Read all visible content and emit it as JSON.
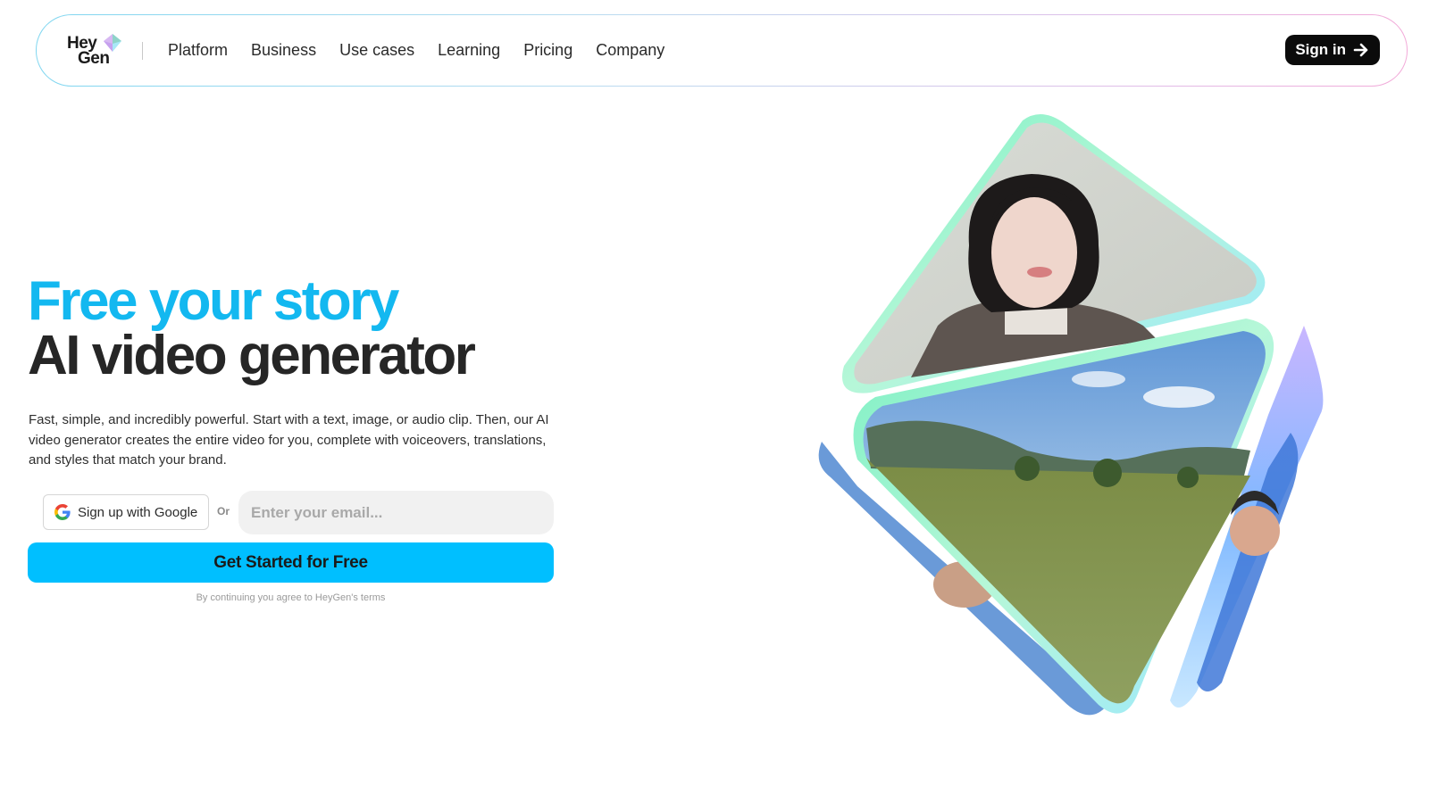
{
  "nav": {
    "logo_line1": "Hey",
    "logo_line2": "Gen",
    "links": [
      "Platform",
      "Business",
      "Use cases",
      "Learning",
      "Pricing",
      "Company"
    ],
    "signin_label": "Sign in"
  },
  "hero": {
    "title_line1": "Free your story",
    "title_line2": "AI video generator",
    "description": "Fast, simple, and incredibly powerful. Start with a text, image, or audio clip. Then, our AI video generator creates the entire video for you, complete with voiceovers, translations, and styles that match your brand.",
    "google_button_label": "Sign up with Google",
    "or_label": "Or",
    "email_placeholder": "Enter your email...",
    "cta_label": "Get Started for Free",
    "terms_text": "By continuing you agree to HeyGen's terms"
  },
  "colors": {
    "accent": "#00BFFF",
    "title_blue": "#13B8F0",
    "dark": "#0B0B0B"
  },
  "icons": [
    "heygen-gem-logo-icon",
    "arrow-right-icon",
    "google-g-icon"
  ]
}
